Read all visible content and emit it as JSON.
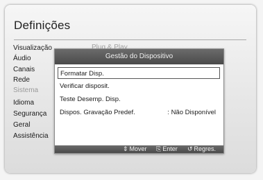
{
  "screen": {
    "title": "Definições"
  },
  "sidebar": {
    "items": [
      {
        "label": "Visualização"
      },
      {
        "label": "Áudio"
      },
      {
        "label": "Canais"
      },
      {
        "label": "Rede"
      },
      {
        "label": "Sistema",
        "active": true
      },
      {
        "label": "Idioma"
      },
      {
        "label": "Segurança"
      },
      {
        "label": "Geral"
      },
      {
        "label": "Assistência"
      }
    ]
  },
  "background_option": {
    "label": "Plug & Play"
  },
  "dialog": {
    "title": "Gestão do Dispositivo",
    "items": [
      {
        "label": "Formatar Disp.",
        "selected": true
      },
      {
        "label": "Verificar disposit."
      },
      {
        "label": "Teste Desemp. Disp."
      },
      {
        "label": "Dispos. Gravação Predef.",
        "value": ": Não Disponível"
      }
    ],
    "footer": {
      "move": {
        "icon": "up-down-arrows-icon",
        "label": "Mover"
      },
      "enter": {
        "icon": "enter-icon",
        "label": "Enter"
      },
      "back": {
        "icon": "return-arrow-icon",
        "label": "Regres."
      }
    }
  }
}
